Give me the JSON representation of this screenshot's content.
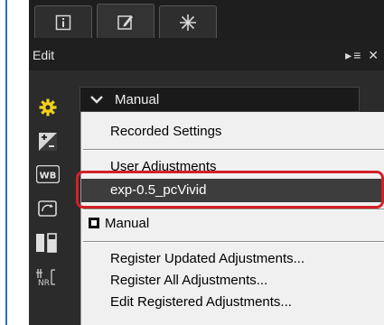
{
  "tabs": [
    {
      "name": "info",
      "icon": "info-icon"
    },
    {
      "name": "edit",
      "icon": "edit-pencil-icon"
    },
    {
      "name": "tools",
      "icon": "star-burst-icon"
    }
  ],
  "title_bar": {
    "title": "Edit",
    "menu_glyph": "▸≡",
    "close_glyph": "✕"
  },
  "tools": [
    {
      "icon": "gear-icon",
      "label": ""
    },
    {
      "icon": "exposure-icon",
      "label": ""
    },
    {
      "icon": "white-balance-icon",
      "label": "WB"
    },
    {
      "icon": "picture-control-icon",
      "label": ""
    },
    {
      "icon": "levels-icon",
      "label": ""
    },
    {
      "icon": "noise-reduction-icon",
      "label": "NR"
    }
  ],
  "picture_control": {
    "selected": "Manual"
  },
  "menu": {
    "recorded_settings": "Recorded Settings",
    "user_adjustments": "User Adjustments",
    "exp_item": "exp-0.5_pcVivid",
    "manual": "Manual",
    "register_updated": "Register Updated Adjustments...",
    "register_all": "Register All Adjustments...",
    "edit_registered": "Edit Registered Adjustments..."
  },
  "colors": {
    "callout": "#d42027",
    "highlight": "#3d3d3d",
    "accent_gear": "#f2d21a"
  }
}
